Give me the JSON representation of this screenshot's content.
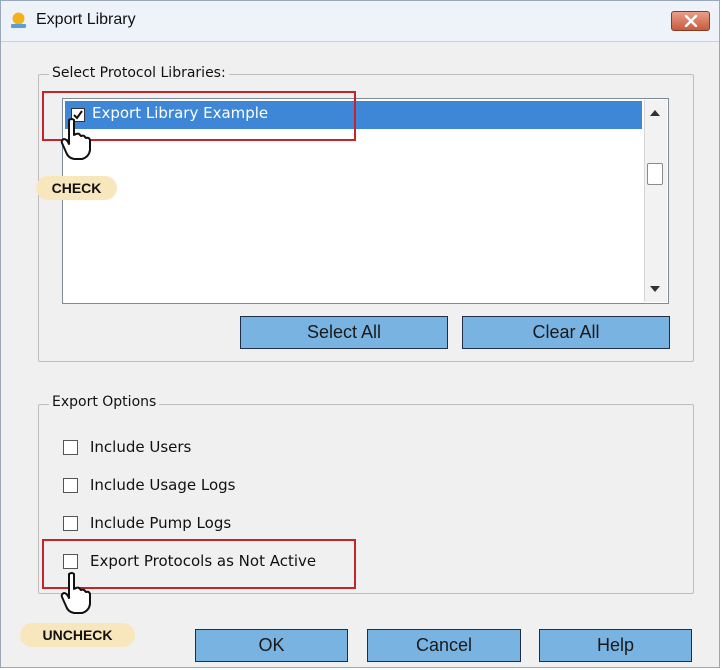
{
  "window": {
    "title": "Export Library"
  },
  "libraries_group": {
    "label": "Select Protocol Libraries:",
    "items": [
      {
        "label": "Export Library Example",
        "checked": true,
        "selected": true
      }
    ],
    "select_all_label": "Select All",
    "clear_all_label": "Clear All"
  },
  "export_options": {
    "label": "Export Options",
    "options": [
      {
        "label": "Include Users",
        "checked": false
      },
      {
        "label": "Include Usage Logs",
        "checked": false
      },
      {
        "label": "Include Pump Logs",
        "checked": false
      },
      {
        "label": "Export Protocols as Not Active",
        "checked": false
      }
    ]
  },
  "footer": {
    "ok_label": "OK",
    "cancel_label": "Cancel",
    "help_label": "Help"
  },
  "annotations": {
    "check_label": "CHECK",
    "uncheck_label": "UNCHECK",
    "highlight_color": "#c4252b",
    "badge_color": "#f8e7bd"
  },
  "colors": {
    "selection": "#3d87d6",
    "button": "#79b3e2"
  }
}
